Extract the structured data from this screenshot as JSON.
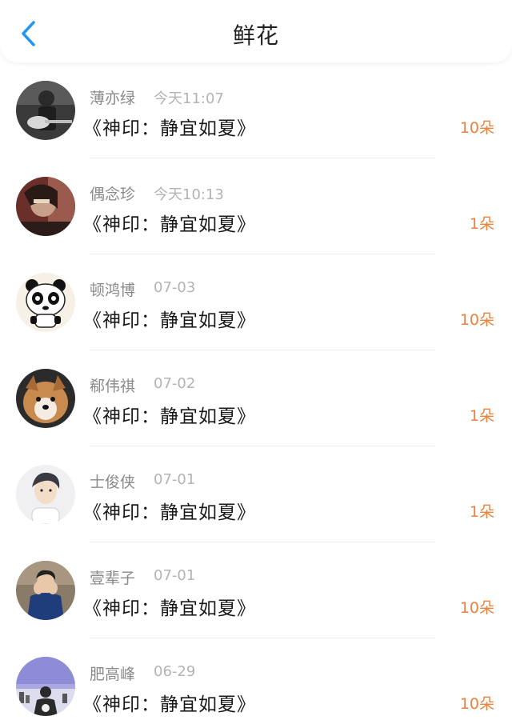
{
  "header": {
    "title": "鲜花",
    "back_icon": "chevron-left-icon",
    "accent_color": "#2196F3"
  },
  "colors": {
    "amount": "#e8823c",
    "username": "#8a8a8a",
    "time": "#b3b3b3"
  },
  "items": [
    {
      "name": "薄亦绿",
      "time": "今天11:07",
      "book": "《神印：静宜如夏》",
      "amount": "10朵",
      "avatar": "guitar-player-photo"
    },
    {
      "name": "偶念珍",
      "time": "今天10:13",
      "book": "《神印：静宜如夏》",
      "amount": "1朵",
      "avatar": "girl-photo"
    },
    {
      "name": "顿鸿博",
      "time": "07-03",
      "book": "《神印：静宜如夏》",
      "amount": "10朵",
      "avatar": "panda-cartoon"
    },
    {
      "name": "郗伟祺",
      "time": "07-02",
      "book": "《神印：静宜如夏》",
      "amount": "1朵",
      "avatar": "dog-photo"
    },
    {
      "name": "士俊侠",
      "time": "07-01",
      "book": "《神印：静宜如夏》",
      "amount": "1朵",
      "avatar": "boy-portrait-photo"
    },
    {
      "name": "壹辈子",
      "time": "07-01",
      "book": "《神印：静宜如夏》",
      "amount": "10朵",
      "avatar": "boy-blue-shirt-photo"
    },
    {
      "name": "肥高峰",
      "time": "06-29",
      "book": "《神印：静宜如夏》",
      "amount": "10朵",
      "avatar": "city-sky-photo"
    }
  ]
}
